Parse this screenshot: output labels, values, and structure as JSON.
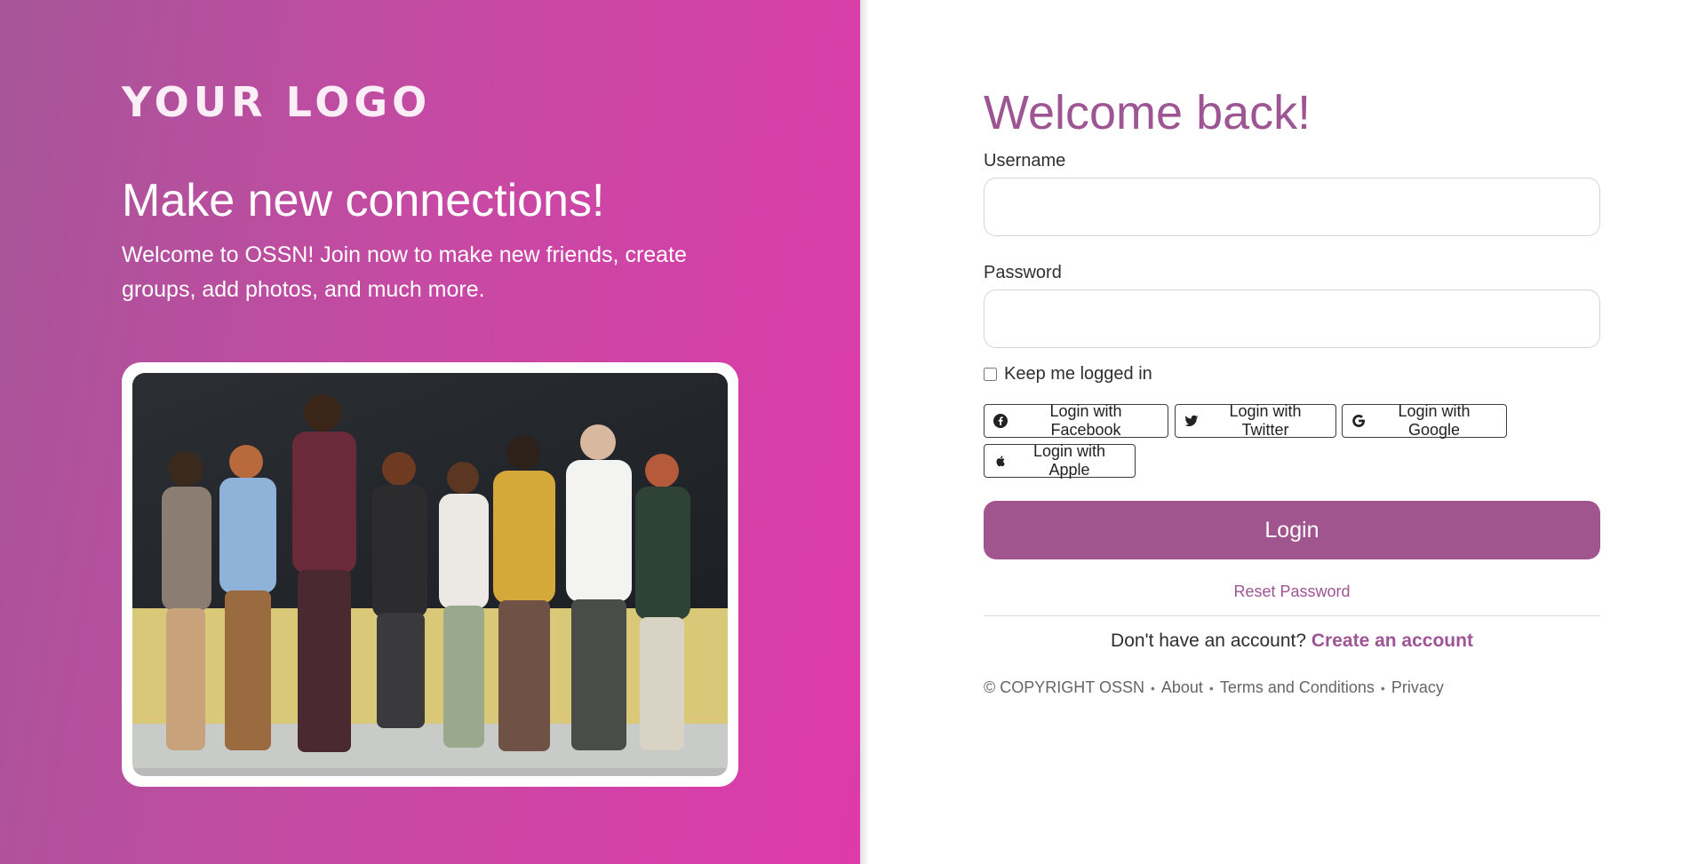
{
  "branding": {
    "logo_text": "YOUR LOGO",
    "hero_title": "Make new connections!",
    "hero_text": "Welcome to OSSN! Join now to make new friends, create groups, add photos, and much more.",
    "photo_icon": "group-photo-image"
  },
  "colors": {
    "accent": "#9d5594",
    "button": "#a0558f",
    "gradient_start": "#a65598",
    "gradient_end": "#de3aa9"
  },
  "login_form": {
    "heading": "Welcome back!",
    "username_label": "Username",
    "username_value": "",
    "password_label": "Password",
    "password_value": "",
    "remember_label": "Keep me logged in",
    "remember_checked": false,
    "social_buttons": [
      {
        "label": "Login with Facebook",
        "icon": "facebook-icon"
      },
      {
        "label": "Login with Twitter",
        "icon": "twitter-icon"
      },
      {
        "label": "Login with Google",
        "icon": "google-icon"
      },
      {
        "label": "Login with Apple",
        "icon": "apple-icon"
      }
    ],
    "login_label": "Login",
    "reset_label": "Reset Password",
    "signup_prompt": "Don't have an account?",
    "signup_link": "Create an account"
  },
  "footer": {
    "copyright": "© COPYRIGHT OSSN",
    "links": [
      "About",
      "Terms and Conditions",
      "Privacy"
    ]
  }
}
